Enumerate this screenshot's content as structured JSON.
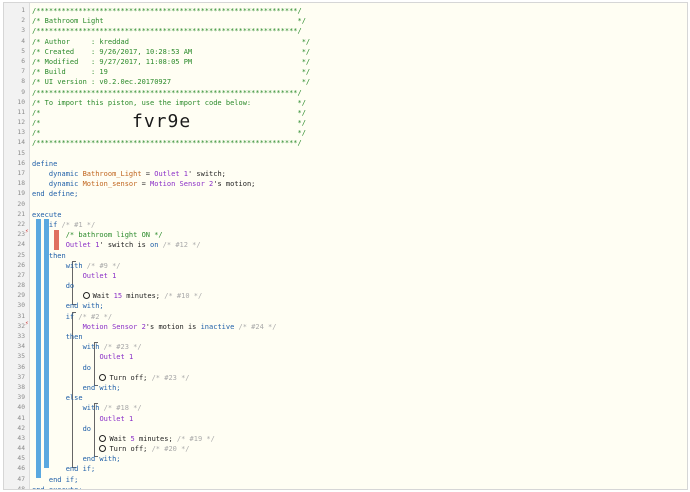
{
  "lines": [
    {
      "n": "1",
      "t": [
        [
          "c",
          "/**************************************************************/"
        ]
      ]
    },
    {
      "n": "2",
      "t": [
        [
          "c",
          "/* Bathroom Light                                              */"
        ]
      ]
    },
    {
      "n": "3",
      "t": [
        [
          "c",
          "/**************************************************************/"
        ]
      ]
    },
    {
      "n": "4",
      "t": [
        [
          "c",
          "/* Author     : kreddad                                         */"
        ]
      ]
    },
    {
      "n": "5",
      "t": [
        [
          "c",
          "/* Created    : 9/26/2017, 10:28:53 AM                          */"
        ]
      ]
    },
    {
      "n": "6",
      "t": [
        [
          "c",
          "/* Modified   : 9/27/2017, 11:08:05 PM                          */"
        ]
      ]
    },
    {
      "n": "7",
      "t": [
        [
          "c",
          "/* Build      : 19                                              */"
        ]
      ]
    },
    {
      "n": "8",
      "t": [
        [
          "c",
          "/* UI version : v0.2.0ec.20170927                               */"
        ]
      ]
    },
    {
      "n": "9",
      "t": [
        [
          "c",
          "/**************************************************************/"
        ]
      ]
    },
    {
      "n": "10",
      "t": [
        [
          "c",
          "/* To import this piston, use the import code below:           */"
        ]
      ]
    },
    {
      "n": "11",
      "t": [
        [
          "c",
          "/*                                                             */"
        ]
      ]
    },
    {
      "n": "12",
      "t": [
        [
          "c",
          "/*                                                             */"
        ]
      ],
      "big": "fvr9e"
    },
    {
      "n": "13",
      "t": [
        [
          "c",
          "/*                                                             */"
        ]
      ]
    },
    {
      "n": "14",
      "t": [
        [
          "c",
          "/**************************************************************/"
        ]
      ]
    },
    {
      "n": "15",
      "t": []
    },
    {
      "n": "16",
      "t": [
        [
          "kw",
          "define"
        ]
      ]
    },
    {
      "n": "17",
      "t": [
        [
          "txt",
          "    "
        ],
        [
          "kw",
          "dynamic "
        ],
        [
          "var",
          "Bathroom_Light"
        ],
        [
          "op",
          " = "
        ],
        [
          "dev",
          "Outlet 1"
        ],
        [
          "txt",
          "' switch;"
        ]
      ]
    },
    {
      "n": "18",
      "t": [
        [
          "txt",
          "    "
        ],
        [
          "kw",
          "dynamic "
        ],
        [
          "var",
          "Motion_sensor"
        ],
        [
          "op",
          " = "
        ],
        [
          "dev",
          "Motion Sensor 2"
        ],
        [
          "txt",
          "'s motion;"
        ]
      ]
    },
    {
      "n": "19",
      "t": [
        [
          "kw",
          "end define;"
        ]
      ]
    },
    {
      "n": "20",
      "t": []
    },
    {
      "n": "21",
      "t": [
        [
          "kw",
          "execute"
        ]
      ]
    },
    {
      "n": "22",
      "t": [
        [
          "txt",
          "    "
        ],
        [
          "kw",
          "if "
        ],
        [
          "cg",
          "/* #1 */"
        ]
      ]
    },
    {
      "n": "23",
      "t": [
        [
          "txt",
          "        "
        ],
        [
          "c",
          "/* bathroom light ON */"
        ]
      ]
    },
    {
      "n": "24",
      "t": [
        [
          "txt",
          "        "
        ],
        [
          "dev",
          "Outlet 1"
        ],
        [
          "txt",
          "' switch is "
        ],
        [
          "kw",
          "on "
        ],
        [
          "cg",
          "/* #12 */"
        ]
      ]
    },
    {
      "n": "25",
      "t": [
        [
          "txt",
          "    "
        ],
        [
          "kw",
          "then"
        ]
      ]
    },
    {
      "n": "26",
      "t": [
        [
          "txt",
          "        "
        ],
        [
          "kw",
          "with "
        ],
        [
          "cg",
          "/* #9 */"
        ]
      ]
    },
    {
      "n": "27",
      "t": [
        [
          "txt",
          "            "
        ],
        [
          "dev",
          "Outlet 1"
        ]
      ]
    },
    {
      "n": "28",
      "t": [
        [
          "txt",
          "        "
        ],
        [
          "kw",
          "do"
        ]
      ]
    },
    {
      "n": "29",
      "t": [
        [
          "txt",
          "            "
        ],
        [
          "icon",
          "clock"
        ],
        [
          "txt",
          "Wait "
        ],
        [
          "dev",
          "15"
        ],
        [
          "txt",
          " minutes; "
        ],
        [
          "cg",
          "/* #10 */"
        ]
      ]
    },
    {
      "n": "30",
      "t": [
        [
          "txt",
          "        "
        ],
        [
          "kw",
          "end with;"
        ]
      ]
    },
    {
      "n": "31",
      "t": [
        [
          "txt",
          "        "
        ],
        [
          "kw",
          "if "
        ],
        [
          "cg",
          "/* #2 */"
        ]
      ]
    },
    {
      "n": "32",
      "t": [
        [
          "txt",
          "            "
        ],
        [
          "dev",
          "Motion Sensor 2"
        ],
        [
          "txt",
          "'s motion is "
        ],
        [
          "kw",
          "inactive "
        ],
        [
          "cg",
          "/* #24 */"
        ]
      ]
    },
    {
      "n": "33",
      "t": [
        [
          "txt",
          "        "
        ],
        [
          "kw",
          "then"
        ]
      ]
    },
    {
      "n": "34",
      "t": [
        [
          "txt",
          "            "
        ],
        [
          "kw",
          "with "
        ],
        [
          "cg",
          "/* #23 */"
        ]
      ]
    },
    {
      "n": "35",
      "t": [
        [
          "txt",
          "                "
        ],
        [
          "dev",
          "Outlet 1"
        ]
      ]
    },
    {
      "n": "36",
      "t": [
        [
          "txt",
          "            "
        ],
        [
          "kw",
          "do"
        ]
      ]
    },
    {
      "n": "37",
      "t": [
        [
          "txt",
          "                "
        ],
        [
          "icon",
          "power"
        ],
        [
          "txt",
          "Turn off; "
        ],
        [
          "cg",
          "/* #23 */"
        ]
      ]
    },
    {
      "n": "38",
      "t": [
        [
          "txt",
          "            "
        ],
        [
          "kw",
          "end with;"
        ]
      ]
    },
    {
      "n": "39",
      "t": [
        [
          "txt",
          "        "
        ],
        [
          "kw",
          "else"
        ]
      ]
    },
    {
      "n": "40",
      "t": [
        [
          "txt",
          "            "
        ],
        [
          "kw",
          "with "
        ],
        [
          "cg",
          "/* #18 */"
        ]
      ]
    },
    {
      "n": "41",
      "t": [
        [
          "txt",
          "                "
        ],
        [
          "dev",
          "Outlet 1"
        ]
      ]
    },
    {
      "n": "42",
      "t": [
        [
          "txt",
          "            "
        ],
        [
          "kw",
          "do"
        ]
      ]
    },
    {
      "n": "43",
      "t": [
        [
          "txt",
          "                "
        ],
        [
          "icon",
          "clock"
        ],
        [
          "txt",
          "Wait "
        ],
        [
          "dev",
          "5"
        ],
        [
          "txt",
          " minutes; "
        ],
        [
          "cg",
          "/* #19 */"
        ]
      ]
    },
    {
      "n": "44",
      "t": [
        [
          "txt",
          "                "
        ],
        [
          "icon",
          "power"
        ],
        [
          "txt",
          "Turn off; "
        ],
        [
          "cg",
          "/* #20 */"
        ]
      ]
    },
    {
      "n": "45",
      "t": [
        [
          "txt",
          "            "
        ],
        [
          "kw",
          "end with;"
        ]
      ]
    },
    {
      "n": "46",
      "t": [
        [
          "txt",
          "        "
        ],
        [
          "kw",
          "end if;"
        ]
      ]
    },
    {
      "n": "47",
      "t": [
        [
          "txt",
          "    "
        ],
        [
          "kw",
          "end if;"
        ]
      ]
    },
    {
      "n": "48",
      "t": [
        [
          "kw",
          "end execute;"
        ]
      ]
    }
  ],
  "icons": {
    "clock": "clock-icon",
    "power": "power-icon",
    "bolt": "lightning-icon"
  },
  "colors": {
    "comment": "#2a8a2a",
    "keyword": "#1f5fa8",
    "variable": "#c0651e",
    "device": "#8a2ec7",
    "block_bar": "#5aa8e0",
    "condition_bar": "#e07060"
  }
}
